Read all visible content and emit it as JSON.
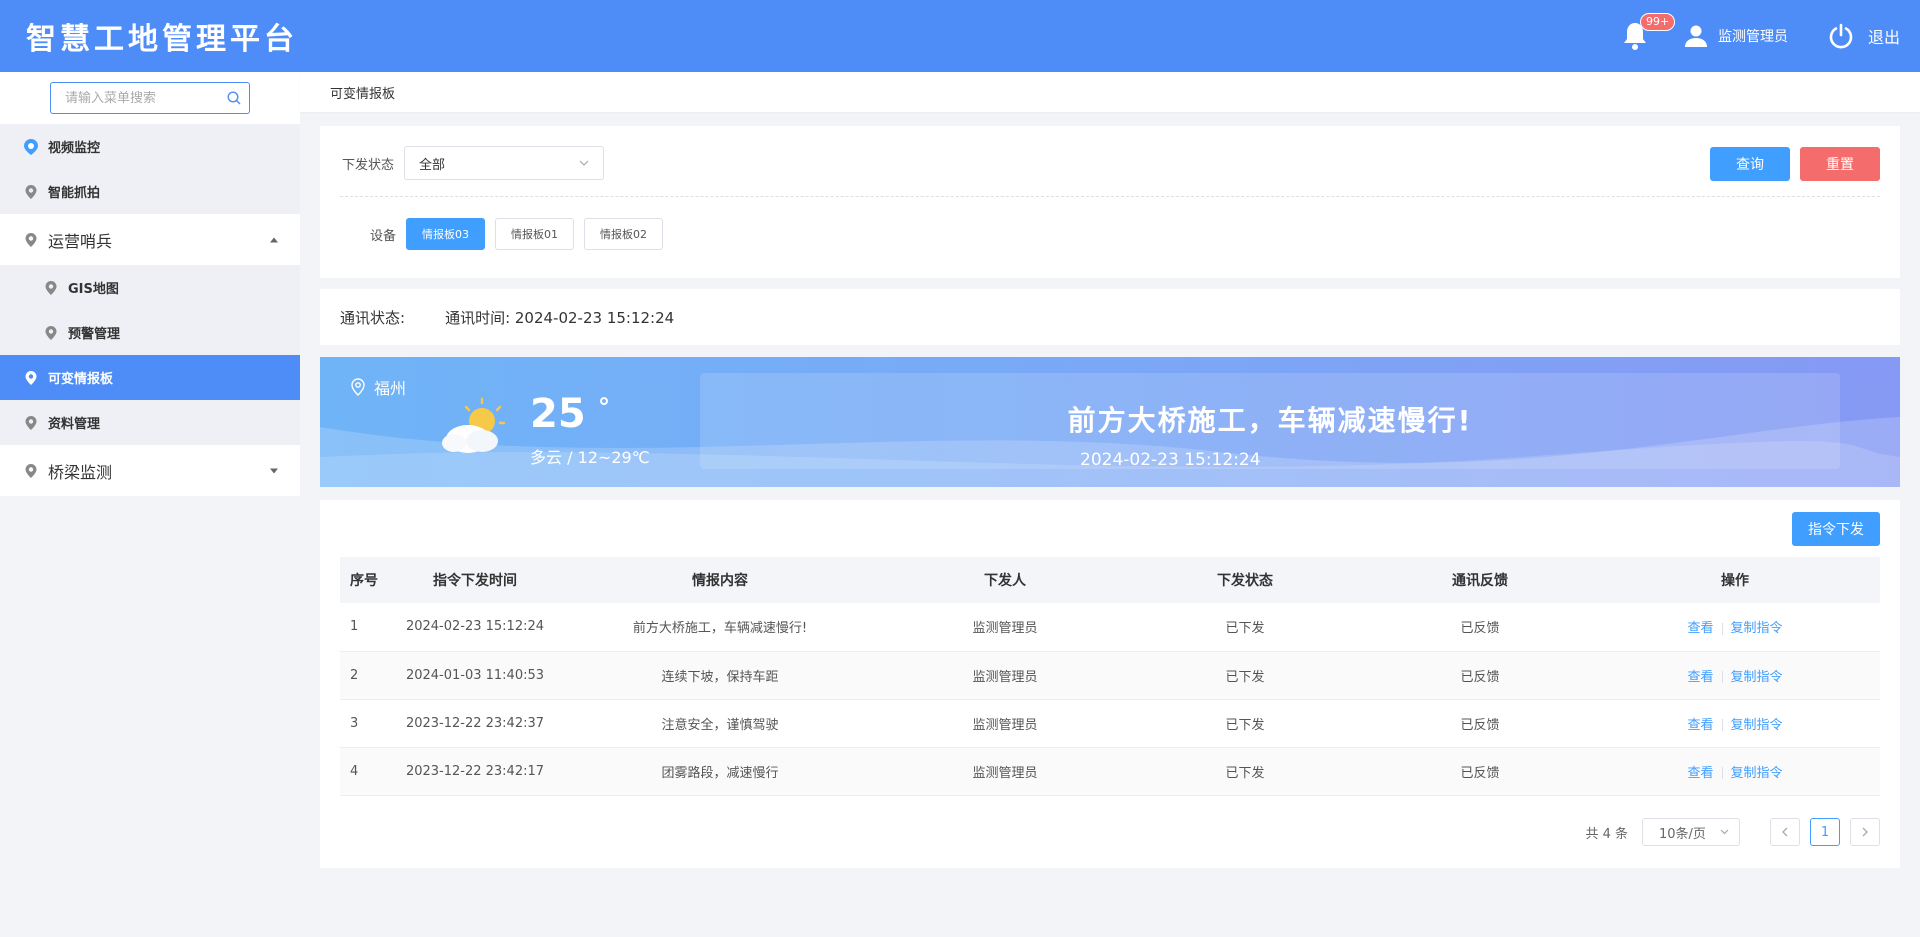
{
  "header": {
    "title": "智慧工地管理平台",
    "badge": "99+",
    "user": "监测管理员",
    "logout": "退出"
  },
  "sidebar": {
    "search_placeholder": "请输入菜单搜索",
    "items": [
      {
        "label": "视频监控",
        "icon": "camera-pin-icon"
      },
      {
        "label": "智能抓拍",
        "icon": "location-pin-icon"
      },
      {
        "label": "运营哨兵",
        "icon": "location-pin-icon",
        "expanded": true
      },
      {
        "label": "GIS地图",
        "icon": "location-pin-icon"
      },
      {
        "label": "预警管理",
        "icon": "location-pin-icon"
      },
      {
        "label": "可变情报板",
        "icon": "location-pin-icon",
        "active": true
      },
      {
        "label": "资料管理",
        "icon": "location-pin-icon"
      },
      {
        "label": "桥梁监测",
        "icon": "location-pin-icon",
        "expanded": false
      }
    ]
  },
  "breadcrumb": "可变情报板",
  "filter": {
    "status_label": "下发状态",
    "status_value": "全部",
    "query": "查询",
    "reset": "重置",
    "device_label": "设备",
    "devices": [
      "情报板03",
      "情报板01",
      "情报板02"
    ],
    "active_device": "情报板03"
  },
  "comm": {
    "status_label": "通讯状态:",
    "time_label": "通讯时间: 2024-02-23 15:12:24"
  },
  "banner": {
    "city": "福州",
    "temp": "25",
    "deg": "°",
    "weather": "多云 / 12~29℃",
    "message": "前方大桥施工，车辆减速慢行!",
    "time": "2024-02-23 15:12:24"
  },
  "table": {
    "issue_button": "指令下发",
    "headers": [
      "序号",
      "指令下发时间",
      "情报内容",
      "下发人",
      "下发状态",
      "通讯反馈",
      "操作"
    ],
    "rows": [
      {
        "idx": "1",
        "time": "2024-02-23 15:12:24",
        "content": "前方大桥施工，车辆减速慢行!",
        "user": "监测管理员",
        "status": "已下发",
        "feedback": "已反馈"
      },
      {
        "idx": "2",
        "time": "2024-01-03 11:40:53",
        "content": "连续下坡，保持车距",
        "user": "监测管理员",
        "status": "已下发",
        "feedback": "已反馈"
      },
      {
        "idx": "3",
        "time": "2023-12-22 23:42:37",
        "content": "注意安全，谨慎驾驶",
        "user": "监测管理员",
        "status": "已下发",
        "feedback": "已反馈"
      },
      {
        "idx": "4",
        "time": "2023-12-22 23:42:17",
        "content": "团雾路段，减速慢行",
        "user": "监测管理员",
        "status": "已下发",
        "feedback": "已反馈"
      }
    ],
    "view_label": "查看",
    "copy_label": "复制指令"
  },
  "pager": {
    "total": "共 4 条",
    "page_size": "10条/页",
    "current": "1"
  }
}
